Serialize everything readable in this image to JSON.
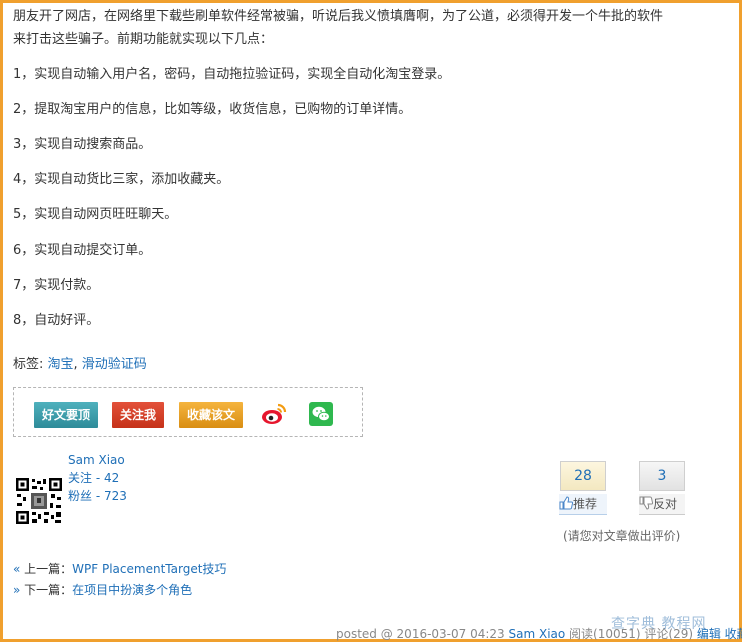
{
  "article": {
    "intro_line1": "朋友开了网店，在网络里下载些刷单软件经常被骗，听说后我义愤填膺啊，为了公道，必须得开发一个牛批的软件",
    "intro_line2": "来打击这些骗子。前期功能就实现以下几点：",
    "items": [
      "1，实现自动输入用户名，密码，自动拖拉验证码，实现全自动化淘宝登录。",
      "2，提取淘宝用户的信息，比如等级，收货信息，已购物的订单详情。",
      "3，实现自动搜索商品。",
      "4，实现自动货比三家，添加收藏夹。",
      "5，实现自动网页旺旺聊天。",
      "6，实现自动提交订单。",
      "7，实现付款。",
      "8，自动好评。"
    ]
  },
  "tags": {
    "label": "标签: ",
    "tag1": "淘宝",
    "sep": ", ",
    "tag2": "滑动验证码"
  },
  "share": {
    "top_label": "好文要顶",
    "follow_label": "关注我",
    "fav_label": "收藏该文",
    "icons": [
      "weibo-icon",
      "wechat-icon"
    ]
  },
  "author": {
    "name": "Sam Xiao",
    "following": "关注 - 42",
    "fans": "粉丝 - 723"
  },
  "vote": {
    "digg_count": "28",
    "digg_label": "推荐",
    "bury_count": "3",
    "bury_label": "反对",
    "hint": "(请您对文章做出评价)"
  },
  "nav": {
    "prev_arrow": "«",
    "prev_label": " 上一篇：",
    "prev_title": "WPF PlacementTarget技巧",
    "next_arrow": "»",
    "next_label": " 下一篇：",
    "next_title": "在项目中扮演多个角色"
  },
  "footer": {
    "posted": "posted @ 2016-03-07 04:23 ",
    "author": "Sam Xiao",
    "reads": " 阅读(10051) 评论(29) ",
    "edit": "编辑 收藏"
  },
  "watermark": "查字典 教程网",
  "colors": {
    "frame": "#f0a02e",
    "link": "#1f6fb7",
    "top_button": "#2e8b99",
    "follow_button": "#c53119",
    "fav_button": "#d98e13"
  }
}
